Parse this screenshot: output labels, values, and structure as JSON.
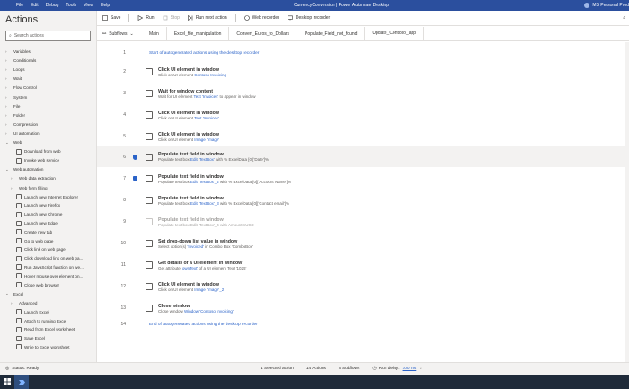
{
  "titlebar": {
    "menu": [
      "File",
      "Edit",
      "Debug",
      "Tools",
      "View",
      "Help"
    ],
    "title": "CurrencyConversion | Power Automate Desktop",
    "user": "MS Personal Prod"
  },
  "left": {
    "heading": "Actions",
    "search_placeholder": "Search actions",
    "groups": [
      {
        "label": "Variables",
        "expanded": false
      },
      {
        "label": "Conditionals",
        "expanded": false
      },
      {
        "label": "Loops",
        "expanded": false
      },
      {
        "label": "Wait",
        "expanded": false
      },
      {
        "label": "Flow Control",
        "expanded": false
      },
      {
        "label": "System",
        "expanded": false
      },
      {
        "label": "File",
        "expanded": false
      },
      {
        "label": "Folder",
        "expanded": false
      },
      {
        "label": "Compression",
        "expanded": false
      },
      {
        "label": "UI automation",
        "expanded": false
      },
      {
        "label": "Web",
        "expanded": true
      }
    ],
    "web_items": [
      "Download from web",
      "Invoke web service"
    ],
    "web_automation": "Web automation",
    "web_data_extraction": "Web data extraction",
    "web_form_filling": "Web form filling",
    "web_auto_items": [
      "Launch new Internet Explorer",
      "Launch new Firefox",
      "Launch new Chrome",
      "Launch new Edge",
      "Create new tab",
      "Go to web page",
      "Click link on web page",
      "Click download link on web pa...",
      "Run JavaScript function on we...",
      "Hover mouse over element on...",
      "Close web browser"
    ],
    "excel": "Excel",
    "advanced": "Advanced",
    "excel_items": [
      "Launch Excel",
      "Attach to running Excel",
      "Read from Excel worksheet",
      "Save Excel",
      "Write to Excel worksheet"
    ]
  },
  "toolbar": {
    "save": "Save",
    "run": "Run",
    "stop": "Stop",
    "run_next": "Run next action",
    "web_recorder": "Web recorder",
    "desktop_recorder": "Desktop recorder"
  },
  "tabs": {
    "subflows": "Subflows",
    "items": [
      "Main",
      "Excel_file_manipulation",
      "Convert_Euros_to_Dollars",
      "Populate_Field_not_found",
      "Update_Contoso_app"
    ],
    "active": 4
  },
  "steps": {
    "start": "Start of autogenerated actions using the desktop recorder",
    "end": "End of autogenerated actions using the desktop recorder",
    "list": [
      {
        "n": "1",
        "type": "plain"
      },
      {
        "n": "2",
        "title": "Click UI element in window",
        "desc": "Click on UI element ",
        "link": "Contoso Invoicing",
        "tail": ""
      },
      {
        "n": "3",
        "title": "Wait for window content",
        "desc": "Wait for UI element ",
        "link": "Text 'Invoices'",
        "tail": " to appear in window"
      },
      {
        "n": "4",
        "title": "Click UI element in window",
        "desc": "Click on UI element ",
        "link": "Text 'Invoices'",
        "tail": ""
      },
      {
        "n": "5",
        "title": "Click UI element in window",
        "desc": "Click on UI element ",
        "link": "Image 'Image'",
        "tail": ""
      },
      {
        "n": "6",
        "title": "Populate text field in window",
        "desc": "Populate text box ",
        "link": "Edit 'TextBox'",
        "tail": " with %  ExcelData  [0]['Date']%",
        "bp": true,
        "hl": true
      },
      {
        "n": "7",
        "title": "Populate text field in window",
        "desc": "Populate text box ",
        "link": "Edit 'TextBox'_2",
        "tail": " with %  ExcelData  [0]['Account Name']%",
        "bp": true
      },
      {
        "n": "8",
        "title": "Populate text field in window",
        "desc": "Populate text box ",
        "link": "Edit 'TextBox'_3",
        "tail": " with %  ExcelData  [0]['Contact email']%"
      },
      {
        "n": "9",
        "title": "Populate text field in window",
        "desc": "Populate text box ",
        "link": "Edit 'TextBox'_4",
        "tail": " with  AmountInUSD ",
        "disabled": true
      },
      {
        "n": "10",
        "title": "Set drop-down list value in window",
        "desc": "Select option(s) ",
        "link": "'Invoiced'",
        "tail": " in Combo Box 'ComboBox'"
      },
      {
        "n": "11",
        "title": "Get details of a UI element in window",
        "desc": "Get attribute ",
        "link": "'ownText'",
        "tail": " of a UI element Text '1026'"
      },
      {
        "n": "12",
        "title": "Click UI element in window",
        "desc": "Click on UI element ",
        "link": "Image 'Image'_2",
        "tail": ""
      },
      {
        "n": "13",
        "title": "Close window",
        "desc": "Close window ",
        "link": "Window 'Contoso Invoicing'",
        "tail": ""
      },
      {
        "n": "14",
        "type": "plain"
      }
    ]
  },
  "status": {
    "ready": "Status: Ready",
    "selected": "1 Selected action",
    "actions": "14 Actions",
    "subflows": "5 Subflows",
    "run_delay_label": "Run delay:",
    "run_delay_value": "100 ms"
  }
}
